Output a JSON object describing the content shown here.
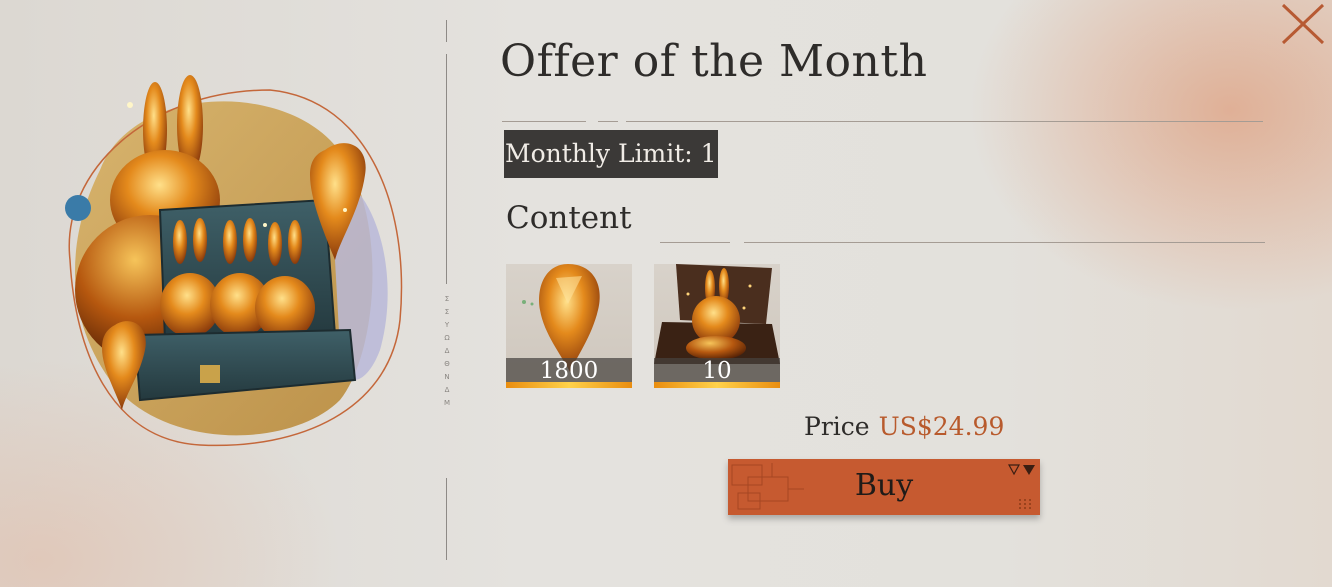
{
  "dialog": {
    "title": "Offer of the Month",
    "monthly_limit": "Monthly Limit: 1",
    "content_heading": "Content",
    "close_icon": "close-x-icon"
  },
  "rewards": [
    {
      "icon": "amber-crystal-icon",
      "quantity": "1800"
    },
    {
      "icon": "rabbit-chest-icon",
      "quantity": "10"
    }
  ],
  "price": {
    "label": "Price",
    "value": "US$24.99"
  },
  "buy_button": {
    "label": "Buy"
  },
  "side_glyphs": [
    "Σ",
    "Σ",
    "Y",
    "Ω",
    "Δ",
    "Θ",
    "N",
    "Δ",
    "M"
  ],
  "colors": {
    "accent": "#c65a30",
    "price": "#b85a2c",
    "badge_bg": "#3b3937",
    "text": "#2e2c2a"
  }
}
